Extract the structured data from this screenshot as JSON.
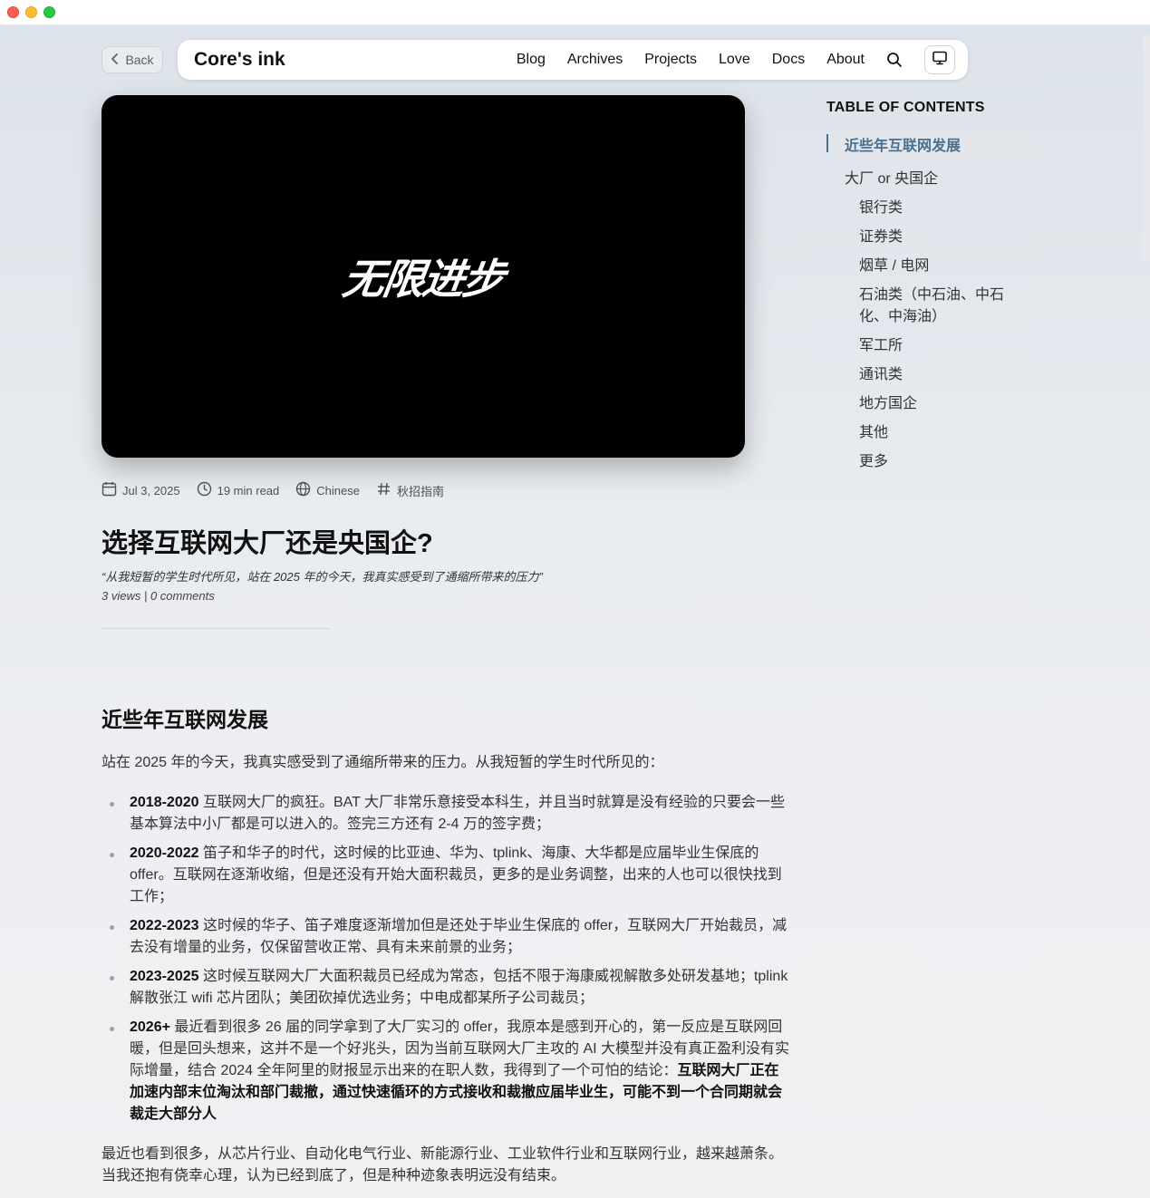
{
  "window": {
    "title": ""
  },
  "back": {
    "label": "Back"
  },
  "nav": {
    "brand": "Core's ink",
    "links": [
      "Blog",
      "Archives",
      "Projects",
      "Love",
      "Docs",
      "About"
    ]
  },
  "hero": {
    "text": "无限进步"
  },
  "meta": {
    "date": "Jul 3, 2025",
    "read_time": "19 min read",
    "language": "Chinese",
    "tag": "秋招指南"
  },
  "post": {
    "title": "选择互联网大厂还是央国企?",
    "quote": "“从我短暂的学生时代所见，站在 2025 年的今天，我真实感受到了通缩所带来的压力”",
    "stats": "3 views | 0 comments"
  },
  "section": {
    "heading": "近些年互联网发展",
    "intro": "站在 2025 年的今天，我真实感受到了通缩所带来的压力。从我短暂的学生时代所见的：",
    "bullets": [
      {
        "year": "2018-2020",
        "text": " 互联网大厂的疯狂。BAT 大厂非常乐意接受本科生，并且当时就算是没有经验的只要会一些基本算法中小厂都是可以进入的。签完三方还有 2-4 万的签字费；"
      },
      {
        "year": "2020-2022",
        "text": " 笛子和华子的时代，这时候的比亚迪、华为、tplink、海康、大华都是应届毕业生保底的 offer。互联网在逐渐收缩，但是还没有开始大面积裁员，更多的是业务调整，出来的人也可以很快找到工作；"
      },
      {
        "year": "2022-2023",
        "text": " 这时候的华子、笛子难度逐渐增加但是还处于毕业生保底的 offer，互联网大厂开始裁员，减去没有增量的业务，仅保留营收正常、具有未来前景的业务；"
      },
      {
        "year": "2023-2025",
        "text": " 这时候互联网大厂大面积裁员已经成为常态，包括不限于海康威视解散多处研发基地；tplink 解散张江 wifi 芯片团队；美团砍掉优选业务；中电成都某所子公司裁员；"
      },
      {
        "year": "2026+",
        "text": " 最近看到很多 26 届的同学拿到了大厂实习的 offer，我原本是感到开心的，第一反应是互联网回暖，但是回头想来，这并不是一个好兆头，因为当前互联网大厂主攻的 AI 大模型并没有真正盈利没有实际增量，结合 2024 全年阿里的财报显示出来的在职人数，我得到了一个可怕的结论：",
        "strong": "互联网大厂正在加速内部末位淘汰和部门裁撤，通过快速循环的方式接收和裁撤应届毕业生，可能不到一个合同期就会裁走大部分人"
      }
    ],
    "outro": "最近也看到很多，从芯片行业、自动化电气行业、新能源行业、工业软件行业和互联网行业，越来越萧条。当我还抱有侥幸心理，认为已经到底了，但是种种迹象表明远没有结束。"
  },
  "toc": {
    "title": "TABLE OF CONTENTS",
    "items": [
      {
        "label": "近些年互联网发展",
        "level": 1,
        "active": true
      },
      {
        "label": "大厂 or 央国企",
        "level": 1
      },
      {
        "label": "银行类",
        "level": 2
      },
      {
        "label": "证券类",
        "level": 2
      },
      {
        "label": "烟草 / 电网",
        "level": 2
      },
      {
        "label": "石油类（中石油、中石化、中海油）",
        "level": 2
      },
      {
        "label": "军工所",
        "level": 2
      },
      {
        "label": "通讯类",
        "level": 2
      },
      {
        "label": "地方国企",
        "level": 2
      },
      {
        "label": "其他",
        "level": 2
      },
      {
        "label": "更多",
        "level": 2
      }
    ]
  },
  "colors": {
    "accent": "#4b6f8e",
    "hero_bg": "#000000"
  }
}
